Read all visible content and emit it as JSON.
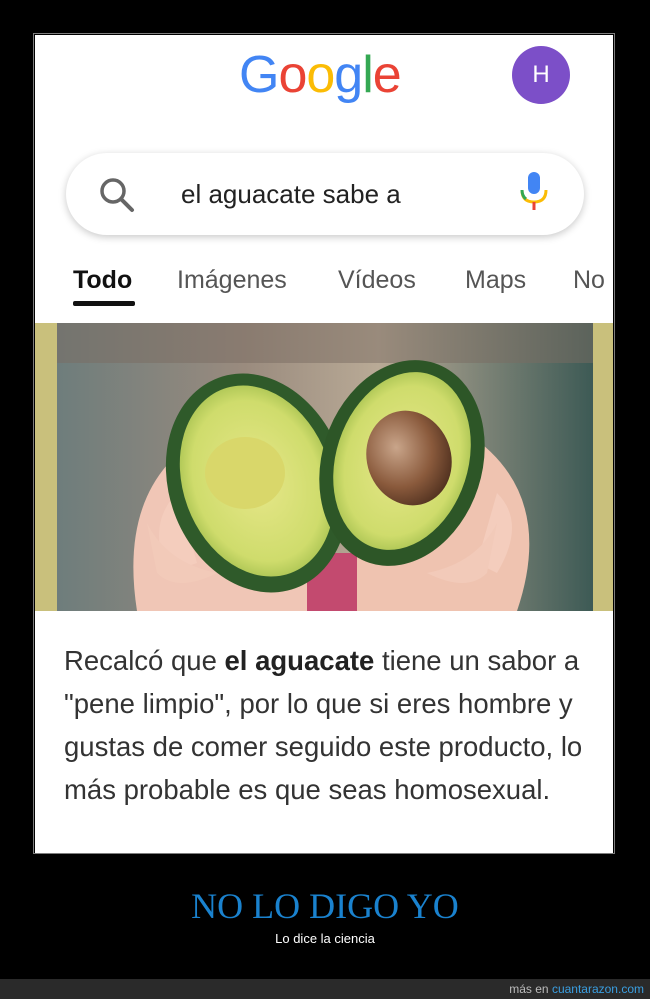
{
  "google": {
    "logo_letters": [
      {
        "ch": "G",
        "color": "#4285F4"
      },
      {
        "ch": "o",
        "color": "#EA4335"
      },
      {
        "ch": "o",
        "color": "#FBBC05"
      },
      {
        "ch": "g",
        "color": "#4285F4"
      },
      {
        "ch": "l",
        "color": "#34A853"
      },
      {
        "ch": "e",
        "color": "#EA4335"
      }
    ],
    "avatar_letter": "H",
    "avatar_color": "#7c4fc8"
  },
  "search": {
    "query": "el aguacate sabe a"
  },
  "tabs": [
    {
      "label": "Todo",
      "active": true
    },
    {
      "label": "Imágenes",
      "active": false
    },
    {
      "label": "Vídeos",
      "active": false
    },
    {
      "label": "Maps",
      "active": false
    },
    {
      "label": "No",
      "active": false
    }
  ],
  "result": {
    "image_description_icon": "avocado-halves-in-hands",
    "snippet_before": "Recalcó que ",
    "snippet_bold": "el aguacate",
    "snippet_after": " tiene un sabor a \"pene limpio\", por lo que si eres hombre y gustas de comer seguido este producto, lo más probable es que seas homosexual."
  },
  "caption": {
    "title": "NO LO DIGO YO",
    "subtitle": "Lo dice la ciencia",
    "title_color": "#1a82ce"
  },
  "footer": {
    "prefix": "más en ",
    "link": "cuantarazon.com"
  }
}
